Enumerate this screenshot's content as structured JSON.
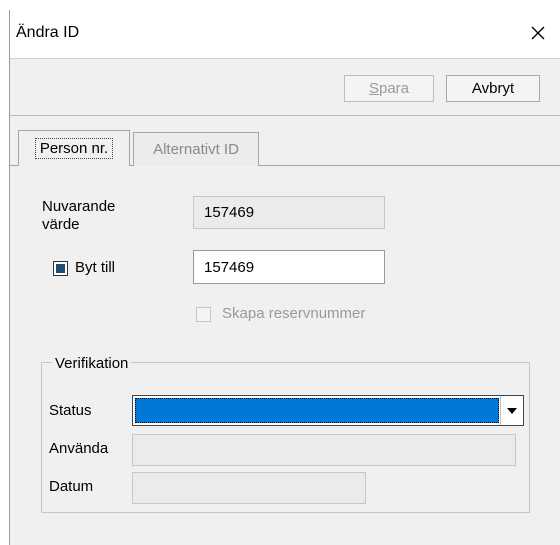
{
  "window": {
    "title": "Ändra ID"
  },
  "toolbar": {
    "save_label": "Spara",
    "save_mnemonic": "S",
    "save_rest": "para",
    "cancel_label": "Avbryt"
  },
  "tabs": [
    {
      "label": "Person nr.",
      "active": true
    },
    {
      "label": "Alternativt ID",
      "active": false
    }
  ],
  "form": {
    "current_label_line1": "Nuvarande",
    "current_label_line2": "värde",
    "current_value": "157469",
    "change_to_label": "Byt till",
    "change_to_checked": true,
    "change_to_value": "157469",
    "reserve_label": "Skapa reservnummer",
    "reserve_checked": false
  },
  "verification": {
    "legend": "Verifikation",
    "status_label": "Status",
    "status_value": "",
    "use_label": "Använda",
    "use_value": "",
    "date_label": "Datum",
    "date_value": ""
  },
  "icons": {
    "close": "close-icon",
    "dropdown": "chevron-down-icon"
  },
  "colors": {
    "selection": "#0078d7",
    "checkbox_fill": "#1f4e79",
    "disabled_text": "#9a9a9a"
  }
}
